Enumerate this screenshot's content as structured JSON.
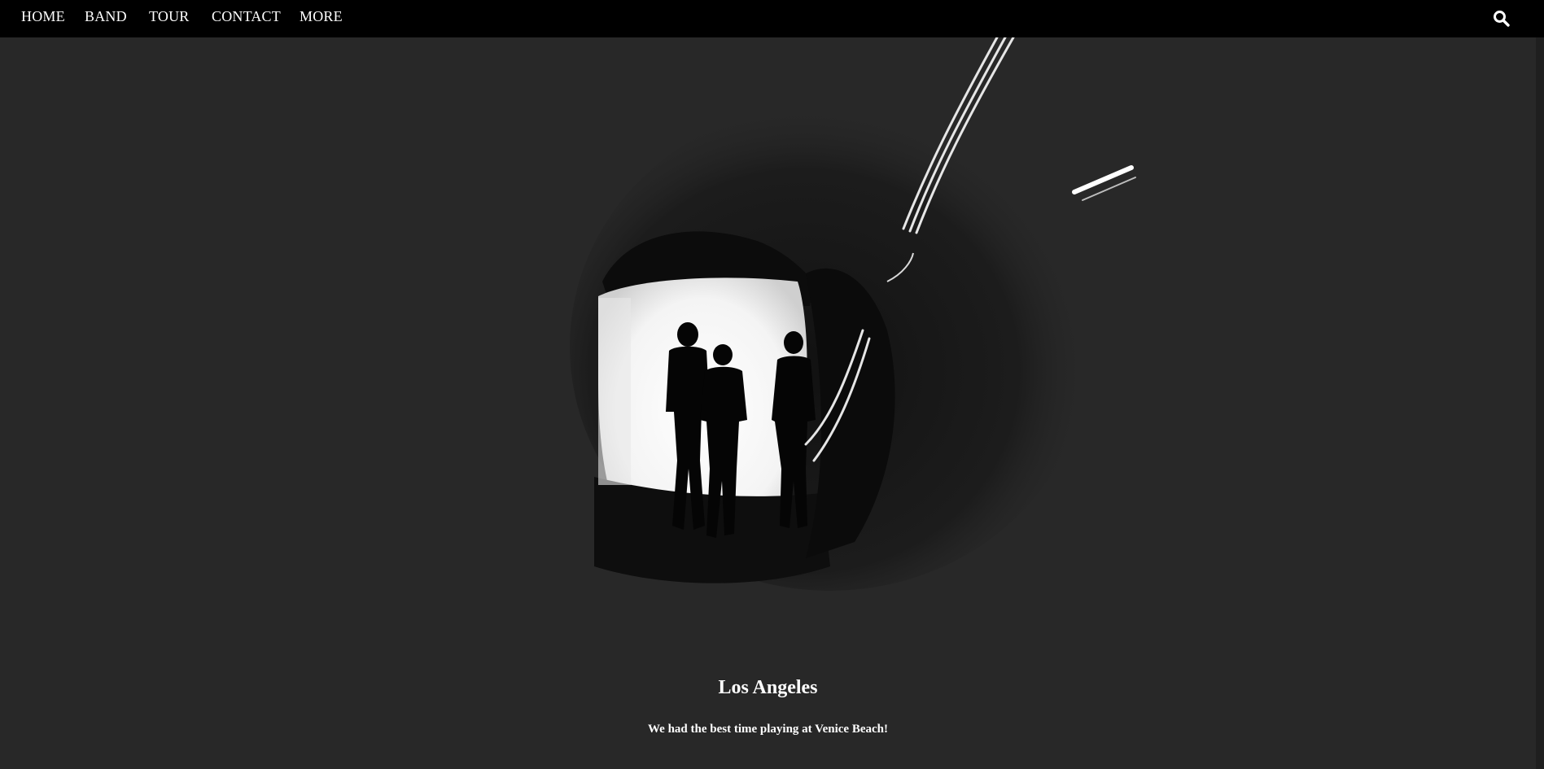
{
  "nav": {
    "items": [
      {
        "label": "HOME"
      },
      {
        "label": "BAND"
      },
      {
        "label": "TOUR"
      },
      {
        "label": "CONTACT"
      },
      {
        "label": "MORE"
      }
    ],
    "search_icon": "search-icon"
  },
  "hero": {
    "image": "band-silhouette-tunnel-photo"
  },
  "caption": {
    "title": "Los Angeles",
    "text": "We had the best time playing at Venice Beach!"
  },
  "colors": {
    "background": "#282828",
    "navbar": "#000000",
    "text": "#ffffff"
  }
}
